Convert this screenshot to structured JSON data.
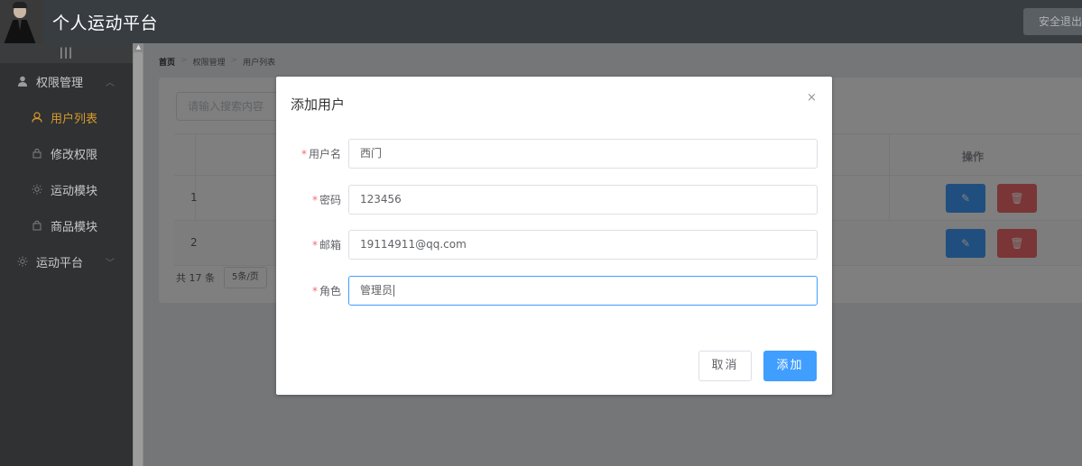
{
  "header": {
    "title": "个人运动平台",
    "logout_label": "安全退出"
  },
  "sidebar": {
    "toggle_label": "|||",
    "items": [
      {
        "label": "权限管理",
        "icon": "user-icon"
      },
      {
        "label": "用户列表",
        "icon": "person-outline-icon",
        "active": true
      },
      {
        "label": "修改权限",
        "icon": "lock-icon"
      },
      {
        "label": "运动模块",
        "icon": "sun-icon"
      },
      {
        "label": "商品模块",
        "icon": "shopping-bag-icon"
      },
      {
        "label": "运动平台",
        "icon": "sun-icon"
      }
    ]
  },
  "breadcrumb": [
    "首页",
    "权限管理",
    "用户列表"
  ],
  "list": {
    "search_placeholder": "请输入搜索内容",
    "column_actions": "操作",
    "rows": [
      {
        "index": "1"
      },
      {
        "index": "2"
      }
    ],
    "total_text": "共 17 条",
    "page_size": "5条/页"
  },
  "dialog": {
    "title": "添加用户",
    "close": "×",
    "fields": [
      {
        "label": "用户名",
        "value": "西门"
      },
      {
        "label": "密码",
        "value": "123456"
      },
      {
        "label": "邮箱",
        "value": "19114911@qq.com"
      },
      {
        "label": "角色",
        "value": "管理员"
      }
    ],
    "required_mark": "*",
    "cancel_label": "取消",
    "submit_label": "添加"
  },
  "colors": {
    "primary": "#409eff",
    "danger": "#f56c6c",
    "active_menu": "#d99a2b"
  }
}
